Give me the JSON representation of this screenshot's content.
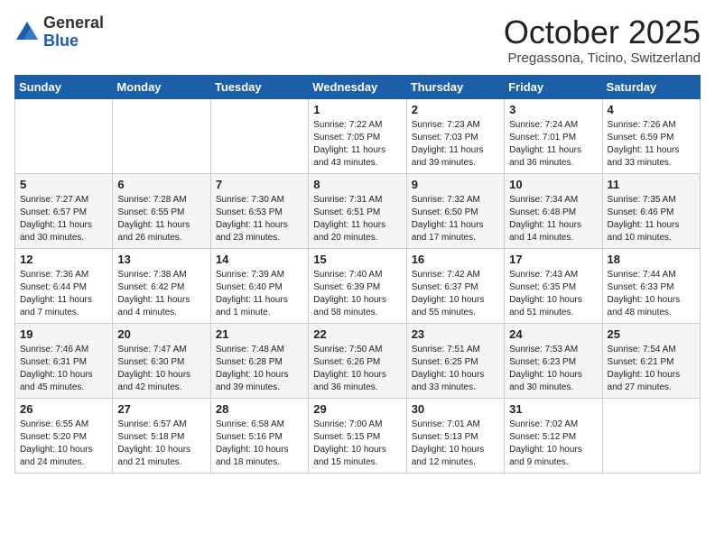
{
  "header": {
    "logo_general": "General",
    "logo_blue": "Blue",
    "month": "October 2025",
    "location": "Pregassona, Ticino, Switzerland"
  },
  "weekdays": [
    "Sunday",
    "Monday",
    "Tuesday",
    "Wednesday",
    "Thursday",
    "Friday",
    "Saturday"
  ],
  "weeks": [
    [
      {
        "day": "",
        "info": ""
      },
      {
        "day": "",
        "info": ""
      },
      {
        "day": "",
        "info": ""
      },
      {
        "day": "1",
        "info": "Sunrise: 7:22 AM\nSunset: 7:05 PM\nDaylight: 11 hours\nand 43 minutes."
      },
      {
        "day": "2",
        "info": "Sunrise: 7:23 AM\nSunset: 7:03 PM\nDaylight: 11 hours\nand 39 minutes."
      },
      {
        "day": "3",
        "info": "Sunrise: 7:24 AM\nSunset: 7:01 PM\nDaylight: 11 hours\nand 36 minutes."
      },
      {
        "day": "4",
        "info": "Sunrise: 7:26 AM\nSunset: 6:59 PM\nDaylight: 11 hours\nand 33 minutes."
      }
    ],
    [
      {
        "day": "5",
        "info": "Sunrise: 7:27 AM\nSunset: 6:57 PM\nDaylight: 11 hours\nand 30 minutes."
      },
      {
        "day": "6",
        "info": "Sunrise: 7:28 AM\nSunset: 6:55 PM\nDaylight: 11 hours\nand 26 minutes."
      },
      {
        "day": "7",
        "info": "Sunrise: 7:30 AM\nSunset: 6:53 PM\nDaylight: 11 hours\nand 23 minutes."
      },
      {
        "day": "8",
        "info": "Sunrise: 7:31 AM\nSunset: 6:51 PM\nDaylight: 11 hours\nand 20 minutes."
      },
      {
        "day": "9",
        "info": "Sunrise: 7:32 AM\nSunset: 6:50 PM\nDaylight: 11 hours\nand 17 minutes."
      },
      {
        "day": "10",
        "info": "Sunrise: 7:34 AM\nSunset: 6:48 PM\nDaylight: 11 hours\nand 14 minutes."
      },
      {
        "day": "11",
        "info": "Sunrise: 7:35 AM\nSunset: 6:46 PM\nDaylight: 11 hours\nand 10 minutes."
      }
    ],
    [
      {
        "day": "12",
        "info": "Sunrise: 7:36 AM\nSunset: 6:44 PM\nDaylight: 11 hours\nand 7 minutes."
      },
      {
        "day": "13",
        "info": "Sunrise: 7:38 AM\nSunset: 6:42 PM\nDaylight: 11 hours\nand 4 minutes."
      },
      {
        "day": "14",
        "info": "Sunrise: 7:39 AM\nSunset: 6:40 PM\nDaylight: 11 hours\nand 1 minute."
      },
      {
        "day": "15",
        "info": "Sunrise: 7:40 AM\nSunset: 6:39 PM\nDaylight: 10 hours\nand 58 minutes."
      },
      {
        "day": "16",
        "info": "Sunrise: 7:42 AM\nSunset: 6:37 PM\nDaylight: 10 hours\nand 55 minutes."
      },
      {
        "day": "17",
        "info": "Sunrise: 7:43 AM\nSunset: 6:35 PM\nDaylight: 10 hours\nand 51 minutes."
      },
      {
        "day": "18",
        "info": "Sunrise: 7:44 AM\nSunset: 6:33 PM\nDaylight: 10 hours\nand 48 minutes."
      }
    ],
    [
      {
        "day": "19",
        "info": "Sunrise: 7:46 AM\nSunset: 6:31 PM\nDaylight: 10 hours\nand 45 minutes."
      },
      {
        "day": "20",
        "info": "Sunrise: 7:47 AM\nSunset: 6:30 PM\nDaylight: 10 hours\nand 42 minutes."
      },
      {
        "day": "21",
        "info": "Sunrise: 7:48 AM\nSunset: 6:28 PM\nDaylight: 10 hours\nand 39 minutes."
      },
      {
        "day": "22",
        "info": "Sunrise: 7:50 AM\nSunset: 6:26 PM\nDaylight: 10 hours\nand 36 minutes."
      },
      {
        "day": "23",
        "info": "Sunrise: 7:51 AM\nSunset: 6:25 PM\nDaylight: 10 hours\nand 33 minutes."
      },
      {
        "day": "24",
        "info": "Sunrise: 7:53 AM\nSunset: 6:23 PM\nDaylight: 10 hours\nand 30 minutes."
      },
      {
        "day": "25",
        "info": "Sunrise: 7:54 AM\nSunset: 6:21 PM\nDaylight: 10 hours\nand 27 minutes."
      }
    ],
    [
      {
        "day": "26",
        "info": "Sunrise: 6:55 AM\nSunset: 5:20 PM\nDaylight: 10 hours\nand 24 minutes."
      },
      {
        "day": "27",
        "info": "Sunrise: 6:57 AM\nSunset: 5:18 PM\nDaylight: 10 hours\nand 21 minutes."
      },
      {
        "day": "28",
        "info": "Sunrise: 6:58 AM\nSunset: 5:16 PM\nDaylight: 10 hours\nand 18 minutes."
      },
      {
        "day": "29",
        "info": "Sunrise: 7:00 AM\nSunset: 5:15 PM\nDaylight: 10 hours\nand 15 minutes."
      },
      {
        "day": "30",
        "info": "Sunrise: 7:01 AM\nSunset: 5:13 PM\nDaylight: 10 hours\nand 12 minutes."
      },
      {
        "day": "31",
        "info": "Sunrise: 7:02 AM\nSunset: 5:12 PM\nDaylight: 10 hours\nand 9 minutes."
      },
      {
        "day": "",
        "info": ""
      }
    ]
  ]
}
